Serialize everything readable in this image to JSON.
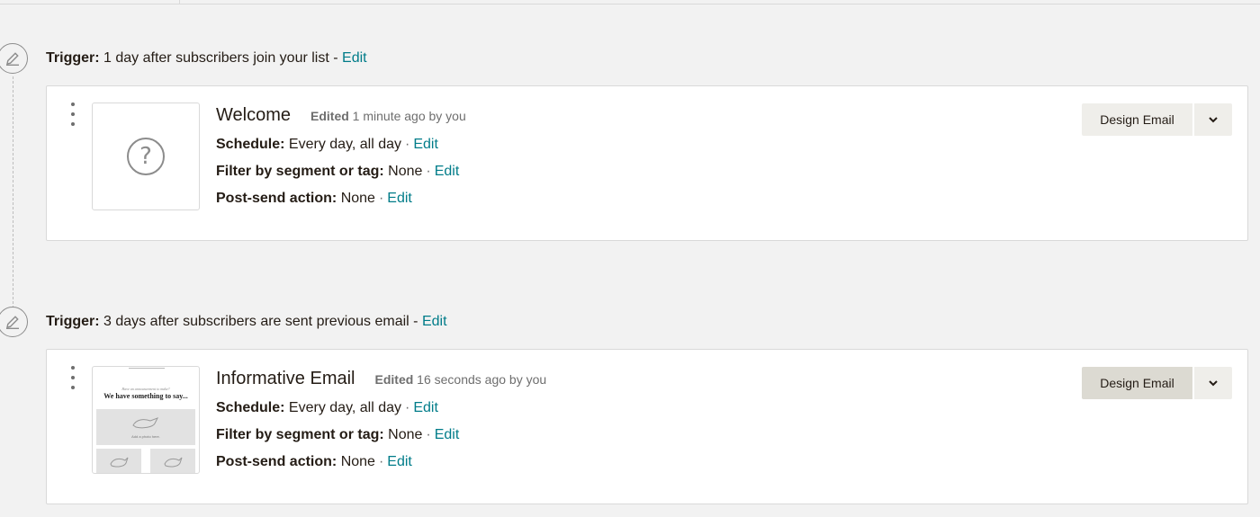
{
  "triggers": [
    {
      "label": "Trigger:",
      "text": "1 day after subscribers join your list -",
      "edit": "Edit"
    },
    {
      "label": "Trigger:",
      "text": "3 days after subscribers are sent previous email -",
      "edit": "Edit"
    }
  ],
  "emails": [
    {
      "name": "Welcome",
      "edited_label": "Edited",
      "edited_text": "1 minute ago by you",
      "thumbnail": "question-mark-placeholder",
      "schedule_label": "Schedule:",
      "schedule_value": "Every day, all day",
      "filter_label": "Filter by segment or tag:",
      "filter_value": "None",
      "post_label": "Post-send action:",
      "post_value": "None",
      "edit": "Edit",
      "separator": "·",
      "design_button": "Design Email"
    },
    {
      "name": "Informative Email",
      "edited_label": "Edited",
      "edited_text": "16 seconds ago by you",
      "thumbnail": "email-template-preview",
      "preview_preheader": "Have an announcement to make?",
      "preview_heading": "We have something to say...",
      "preview_caption": "Add a photo here.",
      "schedule_label": "Schedule:",
      "schedule_value": "Every day, all day",
      "filter_label": "Filter by segment or tag:",
      "filter_value": "None",
      "post_label": "Post-send action:",
      "post_value": "None",
      "edit": "Edit",
      "separator": "·",
      "design_button": "Design Email"
    }
  ],
  "colors": {
    "link": "#007c89",
    "background": "#f2f2f2",
    "button": "#efeeea",
    "button_active": "#dcdad2"
  }
}
